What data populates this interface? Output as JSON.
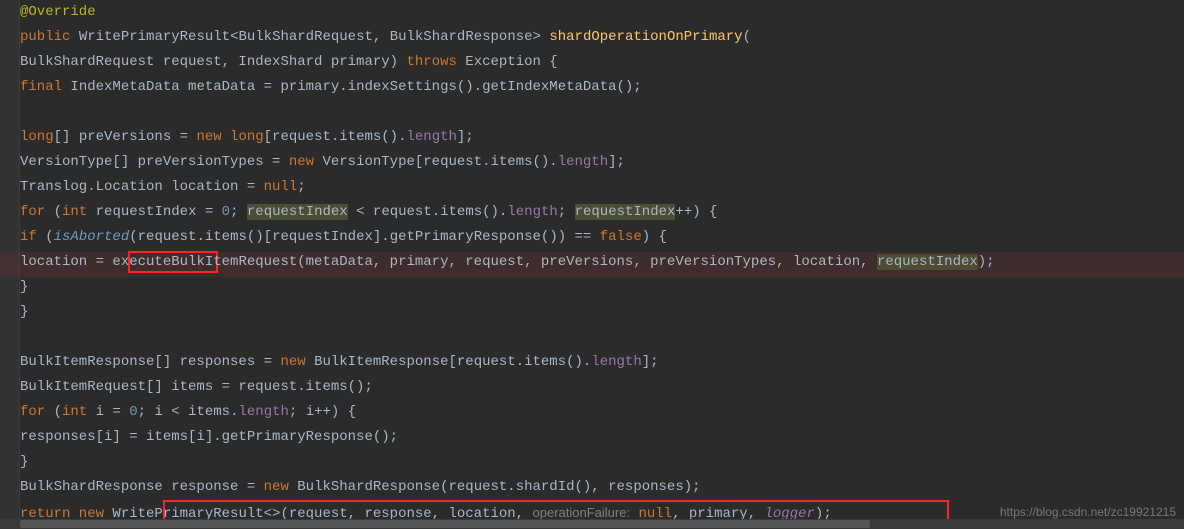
{
  "watermark": "https://blog.csdn.net/zc19921215",
  "code": {
    "l1_annotation": "@Override",
    "l2_public": "public",
    "l2_type1": "WritePrimaryResult",
    "l2_lt": "<",
    "l2_type2": "BulkShardRequest",
    "l2_comma": ", ",
    "l2_type3": "BulkShardResponse",
    "l2_gt": "> ",
    "l2_method": "shardOperationOnPrimary",
    "l2_open": "(",
    "l3_prefix": "        ",
    "l3_type": "BulkShardRequest request,  IndexShard primary) ",
    "l3_throws": "throws",
    "l3_exc": " Exception  {",
    "l4_final": "final",
    "l4_rest": " IndexMetaData metaData = primary.indexSettings().getIndexMetaData();",
    "l6_long": "long",
    "l6_rest_a": "[] preVersions = ",
    "l6_new": "new long",
    "l6_rest_b": "[request.items().",
    "l6_len": "length",
    "l6_rest_c": "];",
    "l7_a": "VersionType[] preVersionTypes = ",
    "l7_new": "new",
    "l7_b": " VersionType[request.items().",
    "l7_len": "length",
    "l7_c": "];",
    "l8_a": "Translog.Location location = ",
    "l8_null": "null",
    "l8_b": ";",
    "l9_for": "for",
    "l9_a": " (",
    "l9_int": "int",
    "l9_b": " requestIndex = ",
    "l9_zero": "0",
    "l9_c": "; ",
    "l9_ri": "requestIndex",
    "l9_d": " < request.items().",
    "l9_len": "length",
    "l9_e": "; ",
    "l9_ri2": "requestIndex",
    "l9_f": "++)  {",
    "l10_if": "if",
    "l10_a": " (",
    "l10_isab": "isAborted",
    "l10_b": "(request.items()[requestIndex].getPrimaryResponse()) == ",
    "l10_false": "false",
    "l10_c": ")  {",
    "l11_pre": "",
    "l11_loc": " location ",
    "l11_a": "= executeBulkItemRequest(metaData,  primary,  request,  preVersions,  preVersionTypes,  location,  ",
    "l11_ri": "requestIndex",
    "l11_b": ");",
    "l12": "    }",
    "l13": "}",
    "l15_a": "BulkItemResponse[] responses = ",
    "l15_new": "new",
    "l15_b": " BulkItemResponse[request.items().",
    "l15_len": "length",
    "l15_c": "];",
    "l16_a": "BulkItemRequest[] items = request.items();",
    "l17_for": "for",
    "l17_a": " (",
    "l17_int": "int",
    "l17_b": " i = ",
    "l17_zero": "0",
    "l17_c": "; i < items.",
    "l17_len": "length",
    "l17_d": "; i++)  {",
    "l18_a": "    responses[i] = items[i].getPrimaryResponse();",
    "l19": "}",
    "l20_a": "BulkShardResponse response = ",
    "l20_new": "new",
    "l20_b": " BulkShardResponse(request.shardId(),  responses);",
    "l21_ret": "return new",
    "l21_a": " WritePrimaryResult<>(request,  response,  location,  ",
    "l21_param": "operationFailure:",
    "l21_null": " null",
    "l21_b": ",  primary,  ",
    "l21_logger": "logger",
    "l21_c": ");"
  }
}
